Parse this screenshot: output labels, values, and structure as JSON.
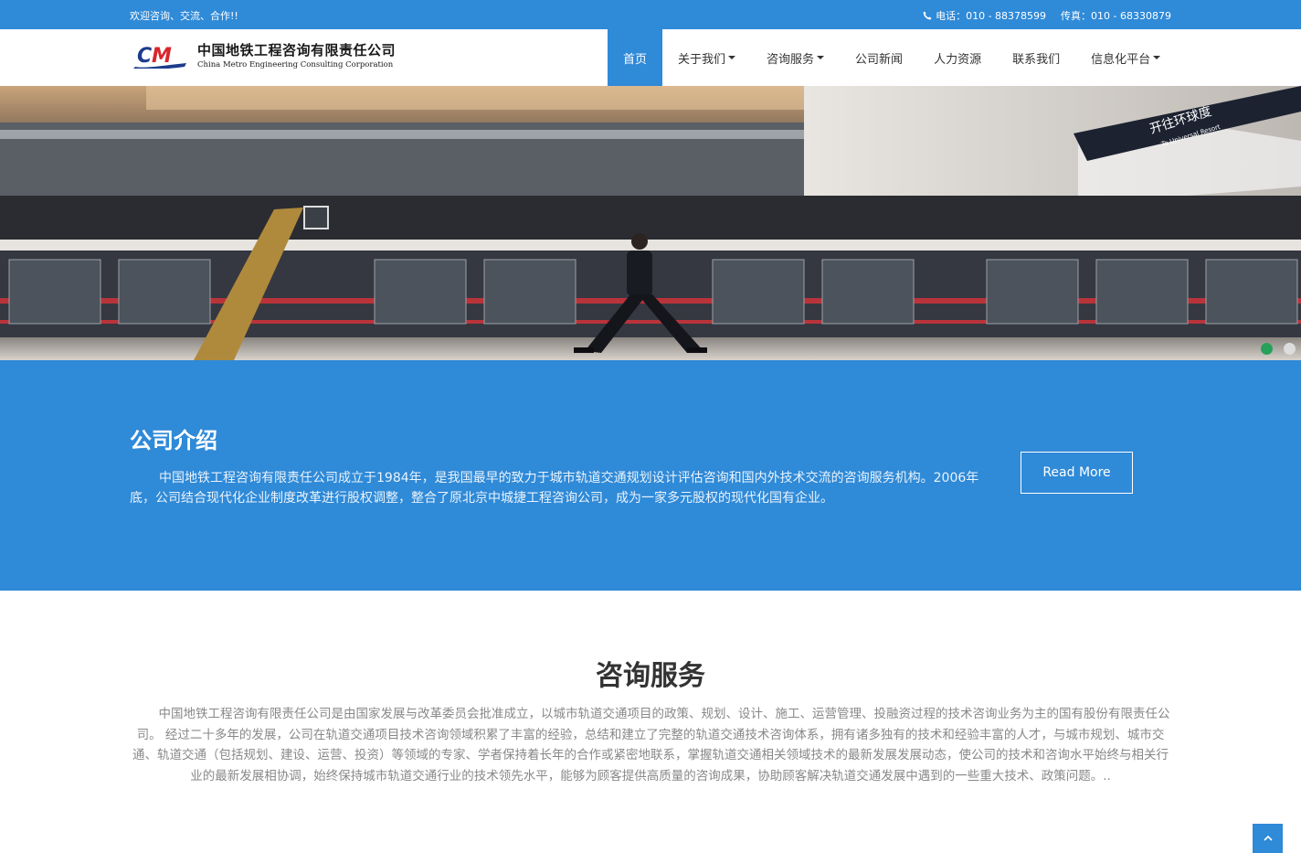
{
  "topbar": {
    "welcome": "欢迎咨询、交流、合作!!",
    "phone": "电话：010 - 88378599",
    "fax": "传真：010 - 68330879"
  },
  "logo": {
    "mark": "CM",
    "name_cn": "中国地铁工程咨询有限责任公司",
    "name_en": "China Metro Engineering Consulting Corporation"
  },
  "nav": [
    {
      "label": "首页",
      "active": true,
      "dropdown": false
    },
    {
      "label": "关于我们",
      "active": false,
      "dropdown": true
    },
    {
      "label": "咨询服务",
      "active": false,
      "dropdown": true
    },
    {
      "label": "公司新闻",
      "active": false,
      "dropdown": false
    },
    {
      "label": "人力资源",
      "active": false,
      "dropdown": false
    },
    {
      "label": "联系我们",
      "active": false,
      "dropdown": false
    },
    {
      "label": "信息化平台",
      "active": false,
      "dropdown": true
    }
  ],
  "banner": {
    "sign_cn": "开往环球度",
    "sign_en": "To Universal Resort",
    "slides_total": 2,
    "active_slide": 1
  },
  "intro": {
    "title": "公司介绍",
    "text": "中国地铁工程咨询有限责任公司成立于1984年，是我国最早的致力于城市轨道交通规划设计评估咨询和国内外技术交流的咨询服务机构。2006年底，公司结合现代化企业制度改革进行股权调整，整合了原北京中城捷工程咨询公司，成为一家多元股权的现代化国有企业。",
    "button": "Read More"
  },
  "services": {
    "title": "咨询服务",
    "text": "中国地铁工程咨询有限责任公司是由国家发展与改革委员会批准成立，以城市轨道交通项目的政策、规划、设计、施工、运营管理、投融资过程的技术咨询业务为主的国有股份有限责任公司。 经过二十多年的发展，公司在轨道交通项目技术咨询领域积累了丰富的经验，总结和建立了完整的轨道交通技术咨询体系，拥有诸多独有的技术和经验丰富的人才，与城市规划、城市交通、轨道交通（包括规划、建设、运营、投资）等领域的专家、学者保持着长年的合作或紧密地联系，掌握轨道交通相关领域技术的最新发展发展动态，使公司的技术和咨询水平始终与相关行业的最新发展相协调，始终保持城市轨道交通行业的技术领先水平，能够为顾客提供高质量的咨询成果，协助顾客解决轨道交通发展中遇到的一些重大技术、政策问题。.."
  },
  "colors": {
    "brand_blue": "#2f8ad8",
    "logo_red": "#d9262c",
    "logo_navy": "#1d3b8c",
    "dot_active": "#27a15a"
  },
  "icons": {
    "phone": "phone-icon",
    "back_to_top": "chevron-up-icon"
  }
}
